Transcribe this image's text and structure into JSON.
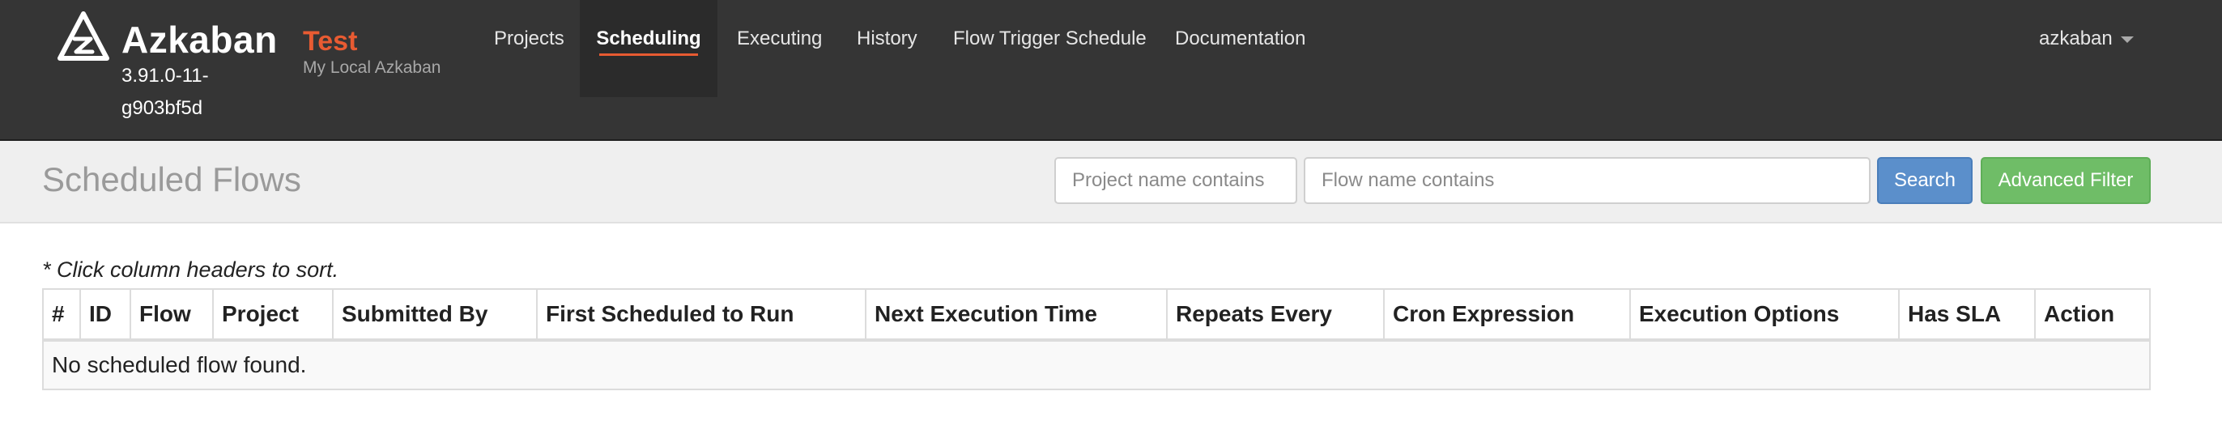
{
  "brand": {
    "name": "Azkaban",
    "version": "3.91.0-11-g903bf5d",
    "env_name": "Test",
    "env_desc": "My Local Azkaban"
  },
  "nav": {
    "items": [
      {
        "label": "Projects"
      },
      {
        "label": "Scheduling",
        "active": true
      },
      {
        "label": "Executing"
      },
      {
        "label": "History"
      },
      {
        "label": "Flow Trigger Schedule"
      },
      {
        "label": "Documentation"
      }
    ],
    "user": "azkaban"
  },
  "header": {
    "title": "Scheduled Flows",
    "project_placeholder": "Project name contains",
    "flow_placeholder": "Flow name contains",
    "search_label": "Search",
    "advanced_label": "Advanced Filter"
  },
  "table": {
    "note": "* Click column headers to sort.",
    "columns": [
      "#",
      "ID",
      "Flow",
      "Project",
      "Submitted By",
      "First Scheduled to Run",
      "Next Execution Time",
      "Repeats Every",
      "Cron Expression",
      "Execution Options",
      "Has SLA",
      "Action"
    ],
    "empty_message": "No scheduled flow found."
  },
  "colors": {
    "navbar": "#353535",
    "accent": "#e85b32",
    "search_button": "#5b8fcb",
    "advanced_button": "#6fbd67"
  }
}
